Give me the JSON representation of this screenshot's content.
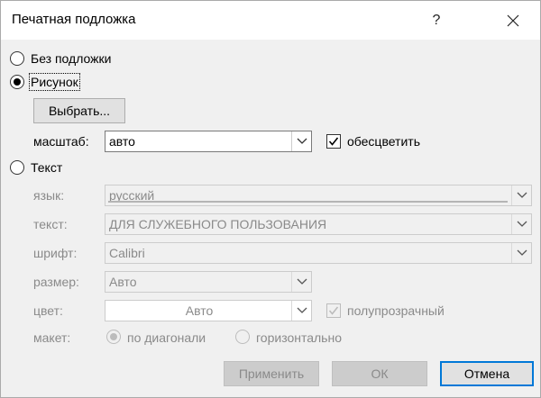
{
  "window": {
    "title": "Печатная подложка"
  },
  "options": {
    "no_watermark": "Без подложки",
    "picture": "Рисунок",
    "text": "Текст"
  },
  "picture": {
    "select_button": "Выбрать...",
    "scale_label": "масштаб:",
    "scale_value": "авто",
    "washout_label": "обесцветить"
  },
  "text_section": {
    "language_label": "язык:",
    "language_value": "русский",
    "text_label": "текст:",
    "text_value": "ДЛЯ СЛУЖЕБНОГО ПОЛЬЗОВАНИЯ",
    "font_label": "шрифт:",
    "font_value": "Calibri",
    "size_label": "размер:",
    "size_value": "Авто",
    "color_label": "цвет:",
    "color_value": "Авто",
    "semitransparent_label": "полупрозрачный",
    "layout_label": "макет:",
    "diagonal_label": "по диагонали",
    "horizontal_label": "горизонтально"
  },
  "buttons": {
    "apply": "Применить",
    "ok": "ОК",
    "cancel": "Отмена"
  },
  "icons": {
    "help": "help-icon",
    "close": "close-icon",
    "dropdown": "chevron-down-icon",
    "check": "check-icon"
  }
}
